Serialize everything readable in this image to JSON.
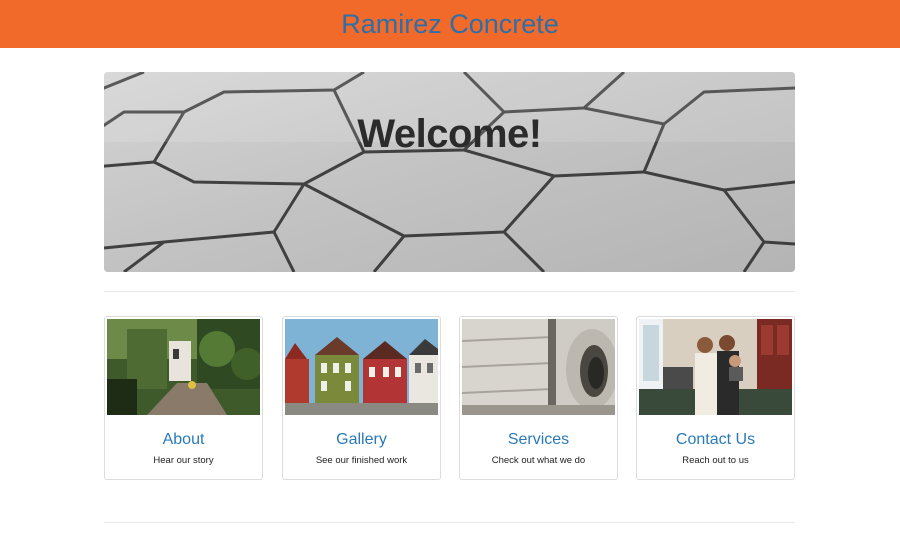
{
  "header": {
    "brand": "Ramirez Concrete",
    "background_color": "#f26a2a",
    "brand_color": "#2d6fa8"
  },
  "hero": {
    "title": "Welcome!",
    "background": "hexagonal concrete pavers photo"
  },
  "cards": [
    {
      "title": "About",
      "subtitle": "Hear our story",
      "image": "garden-path-photo"
    },
    {
      "title": "Gallery",
      "subtitle": "See our finished work",
      "image": "colorful-houses-photo"
    },
    {
      "title": "Services",
      "subtitle": "Check out what we do",
      "image": "concrete-pipes-photo"
    },
    {
      "title": "Contact Us",
      "subtitle": "Reach out to us",
      "image": "family-photo"
    }
  ],
  "colors": {
    "link": "#2a7ab8",
    "card_border": "#dcdcdc"
  }
}
